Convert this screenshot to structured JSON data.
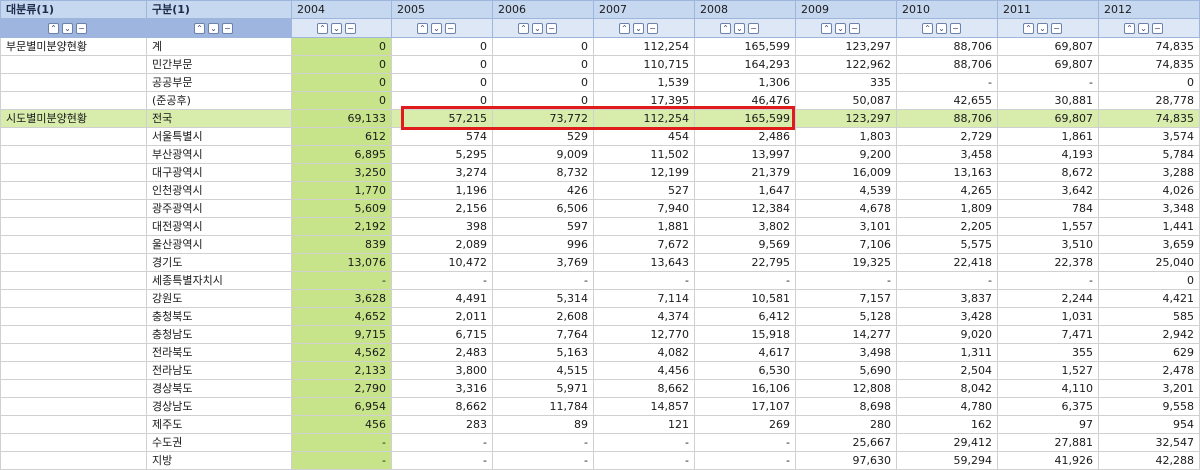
{
  "header": {
    "category_label": "대분류(1)",
    "subcategory_label": "구분(1)",
    "years": [
      "2004",
      "2005",
      "2006",
      "2007",
      "2008",
      "2009",
      "2010",
      "2011",
      "2012"
    ]
  },
  "controls": {
    "up": "⌃",
    "down": "⌄",
    "minus": "−"
  },
  "rows": [
    {
      "cat": "부문별미분양현황",
      "sub": "계",
      "vals": [
        "0",
        "0",
        "0",
        "112,254",
        "165,599",
        "123,297",
        "88,706",
        "69,807",
        "74,835"
      ]
    },
    {
      "cat": "",
      "sub": "민간부문",
      "vals": [
        "0",
        "0",
        "0",
        "110,715",
        "164,293",
        "122,962",
        "88,706",
        "69,807",
        "74,835"
      ]
    },
    {
      "cat": "",
      "sub": "공공부문",
      "vals": [
        "0",
        "0",
        "0",
        "1,539",
        "1,306",
        "335",
        "-",
        "-",
        "0"
      ]
    },
    {
      "cat": "",
      "sub": "(준공후)",
      "vals": [
        "0",
        "0",
        "0",
        "17,395",
        "46,476",
        "50,087",
        "42,655",
        "30,881",
        "28,778"
      ]
    },
    {
      "cat": "시도별미분양현황",
      "sub": "전국",
      "vals": [
        "69,133",
        "57,215",
        "73,772",
        "112,254",
        "165,599",
        "123,297",
        "88,706",
        "69,807",
        "74,835"
      ],
      "highlight": true
    },
    {
      "cat": "",
      "sub": "서울특별시",
      "vals": [
        "612",
        "574",
        "529",
        "454",
        "2,486",
        "1,803",
        "2,729",
        "1,861",
        "3,574"
      ]
    },
    {
      "cat": "",
      "sub": "부산광역시",
      "vals": [
        "6,895",
        "5,295",
        "9,009",
        "11,502",
        "13,997",
        "9,200",
        "3,458",
        "4,193",
        "5,784"
      ]
    },
    {
      "cat": "",
      "sub": "대구광역시",
      "vals": [
        "3,250",
        "3,274",
        "8,732",
        "12,199",
        "21,379",
        "16,009",
        "13,163",
        "8,672",
        "3,288"
      ]
    },
    {
      "cat": "",
      "sub": "인천광역시",
      "vals": [
        "1,770",
        "1,196",
        "426",
        "527",
        "1,647",
        "4,539",
        "4,265",
        "3,642",
        "4,026"
      ]
    },
    {
      "cat": "",
      "sub": "광주광역시",
      "vals": [
        "5,609",
        "2,156",
        "6,506",
        "7,940",
        "12,384",
        "4,678",
        "1,809",
        "784",
        "3,348"
      ]
    },
    {
      "cat": "",
      "sub": "대전광역시",
      "vals": [
        "2,192",
        "398",
        "597",
        "1,881",
        "3,802",
        "3,101",
        "2,205",
        "1,557",
        "1,441"
      ]
    },
    {
      "cat": "",
      "sub": "울산광역시",
      "vals": [
        "839",
        "2,089",
        "996",
        "7,672",
        "9,569",
        "7,106",
        "5,575",
        "3,510",
        "3,659"
      ]
    },
    {
      "cat": "",
      "sub": "경기도",
      "vals": [
        "13,076",
        "10,472",
        "3,769",
        "13,643",
        "22,795",
        "19,325",
        "22,418",
        "22,378",
        "25,040"
      ]
    },
    {
      "cat": "",
      "sub": "세종특별자치시",
      "vals": [
        "-",
        "-",
        "-",
        "-",
        "-",
        "-",
        "-",
        "-",
        "0"
      ]
    },
    {
      "cat": "",
      "sub": "강원도",
      "vals": [
        "3,628",
        "4,491",
        "5,314",
        "7,114",
        "10,581",
        "7,157",
        "3,837",
        "2,244",
        "4,421"
      ]
    },
    {
      "cat": "",
      "sub": "충청북도",
      "vals": [
        "4,652",
        "2,011",
        "2,608",
        "4,374",
        "6,412",
        "5,128",
        "3,428",
        "1,031",
        "585"
      ]
    },
    {
      "cat": "",
      "sub": "충청남도",
      "vals": [
        "9,715",
        "6,715",
        "7,764",
        "12,770",
        "15,918",
        "14,277",
        "9,020",
        "7,471",
        "2,942"
      ]
    },
    {
      "cat": "",
      "sub": "전라북도",
      "vals": [
        "4,562",
        "2,483",
        "5,163",
        "4,082",
        "4,617",
        "3,498",
        "1,311",
        "355",
        "629"
      ]
    },
    {
      "cat": "",
      "sub": "전라남도",
      "vals": [
        "2,133",
        "3,800",
        "4,515",
        "4,456",
        "6,530",
        "5,690",
        "2,504",
        "1,527",
        "2,478"
      ]
    },
    {
      "cat": "",
      "sub": "경상북도",
      "vals": [
        "2,790",
        "3,316",
        "5,971",
        "8,662",
        "16,106",
        "12,808",
        "8,042",
        "4,110",
        "3,201"
      ]
    },
    {
      "cat": "",
      "sub": "경상남도",
      "vals": [
        "6,954",
        "8,662",
        "11,784",
        "14,857",
        "17,107",
        "8,698",
        "4,780",
        "6,375",
        "9,558"
      ]
    },
    {
      "cat": "",
      "sub": "제주도",
      "vals": [
        "456",
        "283",
        "89",
        "121",
        "269",
        "280",
        "162",
        "97",
        "954"
      ]
    },
    {
      "cat": "",
      "sub": "수도권",
      "vals": [
        "-",
        "-",
        "-",
        "-",
        "-",
        "25,667",
        "29,412",
        "27,881",
        "32,547"
      ]
    },
    {
      "cat": "",
      "sub": "지방",
      "vals": [
        "-",
        "-",
        "-",
        "-",
        "-",
        "97,630",
        "59,294",
        "41,926",
        "42,288"
      ]
    }
  ],
  "colors": {
    "header_bg": "#c6d7f0",
    "col2004_bg": "#c8e48a",
    "highlight_row_bg": "#d8ecac",
    "annotation_border": "#e01b1b"
  }
}
